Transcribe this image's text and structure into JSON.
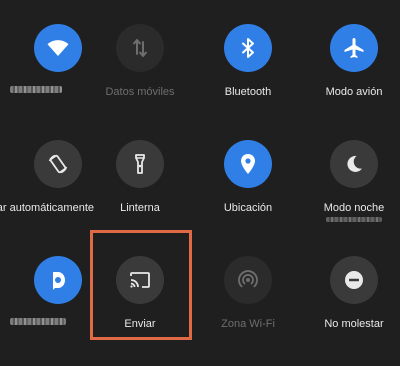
{
  "tiles": {
    "wifi": {
      "label": "",
      "icon": "wifi-icon",
      "state": "on"
    },
    "mobile_data": {
      "label": "Datos móviles",
      "icon": "mobile-data-icon",
      "state": "disabled"
    },
    "bluetooth": {
      "label": "Bluetooth",
      "icon": "bluetooth-icon",
      "state": "on"
    },
    "airplane": {
      "label": "Modo avión",
      "icon": "airplane-icon",
      "state": "on"
    },
    "auto_rotate": {
      "label": "ar automáticamente",
      "icon": "auto-rotate-icon",
      "state": "off"
    },
    "flashlight": {
      "label": "Linterna",
      "icon": "flashlight-icon",
      "state": "off"
    },
    "location": {
      "label": "Ubicación",
      "icon": "location-pin-icon",
      "state": "on"
    },
    "night_mode": {
      "label": "Modo noche",
      "icon": "moon-icon",
      "state": "off"
    },
    "app_shortcut": {
      "label": "",
      "icon": "app-d-icon",
      "state": "on"
    },
    "cast": {
      "label": "Enviar",
      "icon": "cast-icon",
      "state": "off"
    },
    "hotspot": {
      "label": "Zona Wi-Fi",
      "icon": "hotspot-icon",
      "state": "disabled"
    },
    "do_not_disturb": {
      "label": "No molestar",
      "icon": "do-not-disturb-icon",
      "state": "off"
    }
  },
  "colors": {
    "background": "#1f1f1f",
    "active": "#2f7fe6",
    "inactive": "#3a3a3a",
    "highlight": "#e06a46"
  }
}
